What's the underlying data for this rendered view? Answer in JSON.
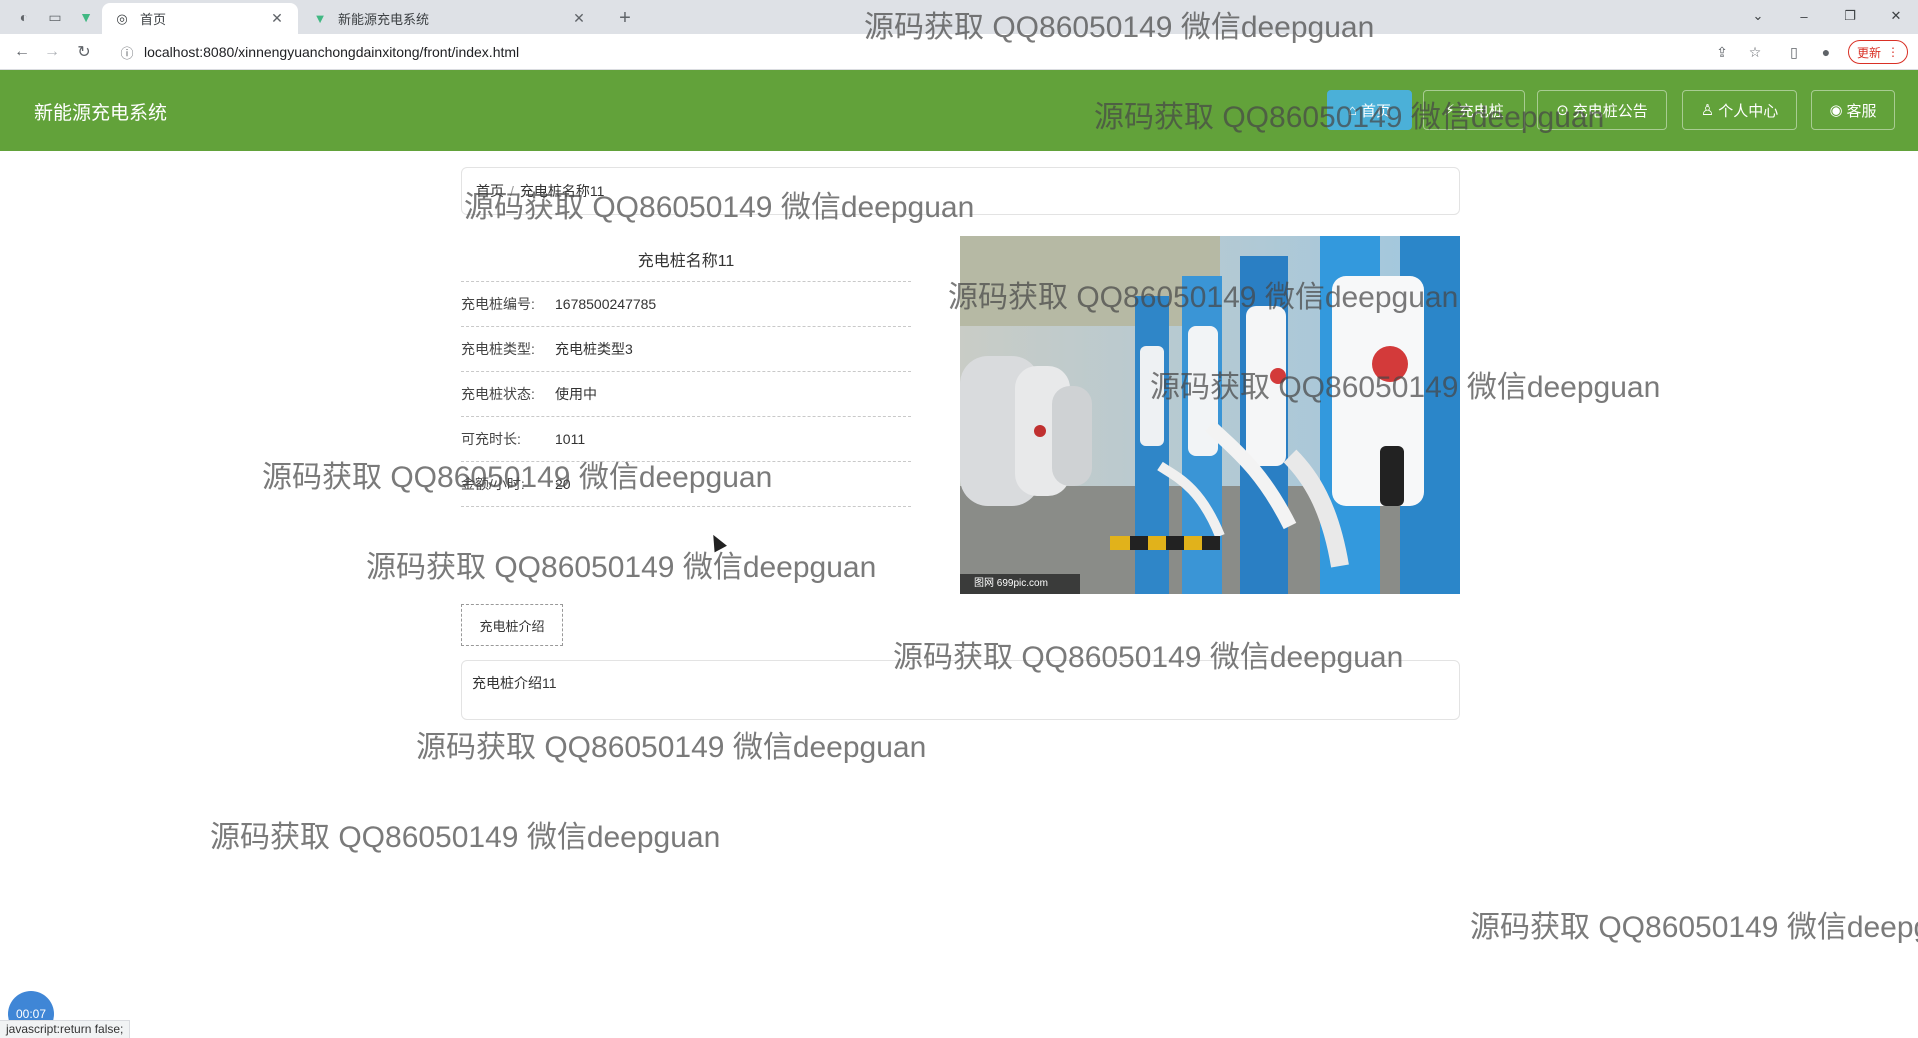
{
  "browser": {
    "tabs": [
      {
        "label": "首页",
        "active": true
      },
      {
        "label": "新能源充电系统",
        "active": false
      }
    ],
    "url": "localhost:8080/xinnengyuanchongdainxitong/front/index.html",
    "update_label": "更新",
    "status_text": "javascript:return false;"
  },
  "site": {
    "title": "新能源充电系统",
    "nav": [
      {
        "label": "首页",
        "icon": "home-icon",
        "active": true
      },
      {
        "label": "充电桩",
        "icon": "charger-icon",
        "active": false
      },
      {
        "label": "充电桩公告",
        "icon": "notice-icon",
        "active": false
      },
      {
        "label": "个人中心",
        "icon": "user-icon",
        "active": false
      },
      {
        "label": "客服",
        "icon": "service-icon",
        "active": false
      }
    ]
  },
  "breadcrumb": {
    "home": "首页",
    "separator": "/",
    "current": "充电桩名称11"
  },
  "detail": {
    "title": "充电桩名称11",
    "rows": [
      {
        "label": "充电桩编号:",
        "value": "1678500247785"
      },
      {
        "label": "充电桩类型:",
        "value": "充电桩类型3"
      },
      {
        "label": "充电桩状态:",
        "value": "使用中"
      },
      {
        "label": "可充时长:",
        "value": "1011"
      },
      {
        "label": "金额/小时:",
        "value": "20"
      }
    ]
  },
  "intro": {
    "tab_label": "充电桩介绍",
    "content": "充电桩介绍11"
  },
  "photo": {
    "caption": "图网 699pic.com"
  },
  "watermark": "源码获取 QQ86050149 微信deepguan",
  "recorder": {
    "time": "00:07"
  },
  "colors": {
    "header_bg": "#62a23a",
    "nav_active_bg": "#4bb0d8",
    "update_accent": "#d93025"
  }
}
